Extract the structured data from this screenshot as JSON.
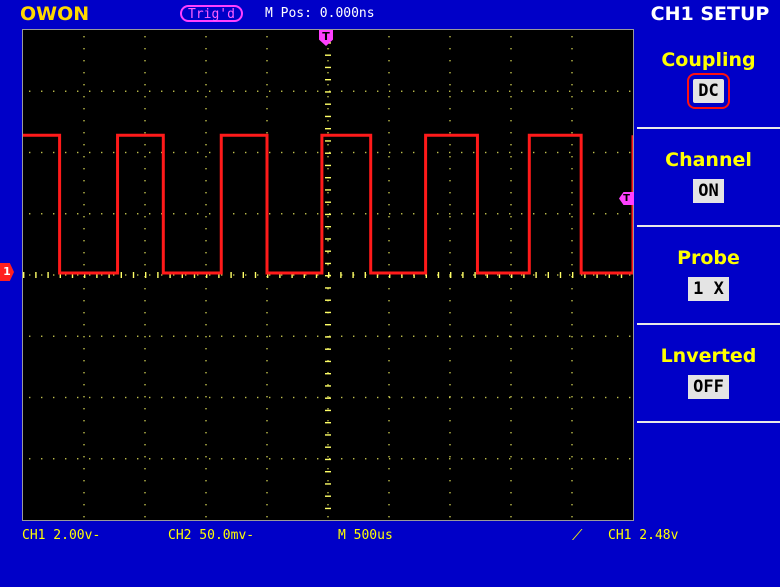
{
  "header": {
    "brand": "OWON",
    "trigger_status": "Trig'd",
    "m_pos": "M Pos: 0.000ns",
    "menu_title": "CH1 SETUP"
  },
  "markers": {
    "trigger_position": "T",
    "ch1_ground": "1",
    "trigger_level": "T"
  },
  "side_menu": {
    "items": [
      {
        "label": "Coupling",
        "value": "DC",
        "selected": true
      },
      {
        "label": "Channel",
        "value": "ON"
      },
      {
        "label": "Probe",
        "value": "1 X"
      },
      {
        "label": "Lnverted",
        "value": "OFF"
      }
    ]
  },
  "status": {
    "ch1": "CH1 2.00v-",
    "ch2": "CH2 50.0mv-",
    "timebase": "M 500us",
    "trigger": "CH1 2.48v"
  },
  "colors": {
    "background": "#0000c8",
    "trace_ch1": "#ff1a1a",
    "graticule": "#ffff66",
    "trigger_marker": "#ff40ff"
  },
  "waveform": {
    "type": "square",
    "channel": "CH1",
    "high_level_div": 2.5,
    "low_level_div": 0,
    "period_div": 1.7,
    "edges_div": [
      0.6,
      1.55,
      2.3,
      3.25,
      4.0,
      4.9,
      5.7,
      6.6,
      7.45,
      8.3,
      9.15,
      10.0
    ]
  }
}
